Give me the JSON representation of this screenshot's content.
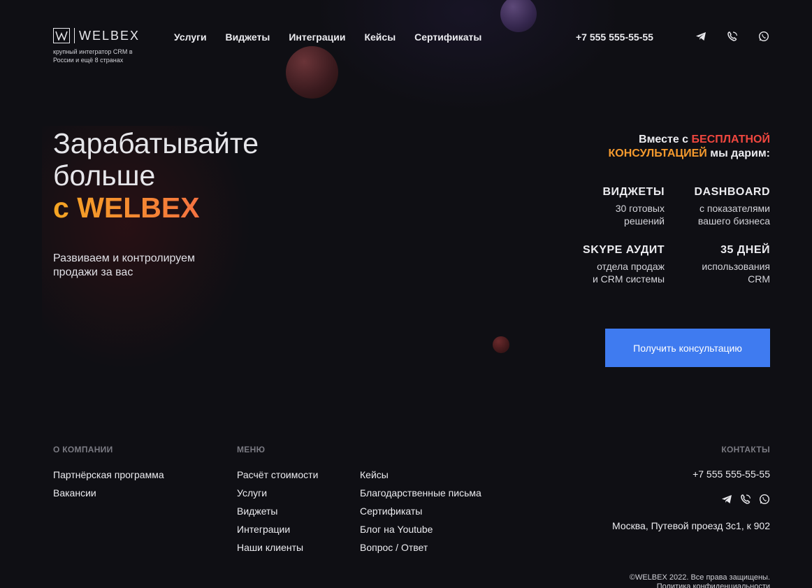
{
  "brand": {
    "name": "WELBEX",
    "tagline": "крупный интегратор CRM в России и ещё 8 странах"
  },
  "nav": [
    "Услуги",
    "Виджеты",
    "Интеграции",
    "Кейсы",
    "Сертификаты"
  ],
  "header_phone": "+7 555 555-55-55",
  "social_icons": [
    "telegram-icon",
    "viber-icon",
    "whatsapp-icon"
  ],
  "hero": {
    "line1": "Зарабатывайте",
    "line2": "больше",
    "brand_line": "с WELBEX",
    "subtitle": "Развиваем и контролируем продажи за вас"
  },
  "offer": {
    "part1": "Вместе с ",
    "part2": "БЕСПЛАТНОЙ",
    "part3": "КОНСУЛЬТАЦИЕЙ",
    "part4": " мы дарим:"
  },
  "features": [
    {
      "title": "ВИДЖЕТЫ",
      "desc": "30 готовых\nрешений"
    },
    {
      "title": "DASHBOARD",
      "desc": "с показателями\nвашего бизнеса"
    },
    {
      "title": "SKYPE АУДИТ",
      "desc": "отдела продаж\nи CRM системы"
    },
    {
      "title": "35 ДНЕЙ",
      "desc": "использования\nCRM"
    }
  ],
  "cta_label": "Получить консультацию",
  "footer": {
    "company_heading": "О КОМПАНИИ",
    "company_links": [
      "Партнёрская программа",
      "Вакансии"
    ],
    "menu_heading": "МЕНЮ",
    "menu_col1": [
      "Расчёт стоимости",
      "Услуги",
      "Виджеты",
      "Интеграции",
      "Наши клиенты"
    ],
    "menu_col2": [
      "Кейсы",
      "Благодарственные письма",
      "Сертификаты",
      "Блог на Youtube",
      "Вопрос / Ответ"
    ],
    "contacts_heading": "КОНТАКТЫ",
    "phone": "+7 555 555-55-55",
    "address": "Москва, Путевой проезд 3с1, к 902",
    "copyright": "©WELBEX 2022. Все права защищены.",
    "privacy": "Политика конфиденциальности"
  },
  "colors": {
    "background": "#0f0f14",
    "accent_blue": "#3f7bf0",
    "accent_orange": "#f59a2e",
    "accent_red": "#f0473f"
  }
}
